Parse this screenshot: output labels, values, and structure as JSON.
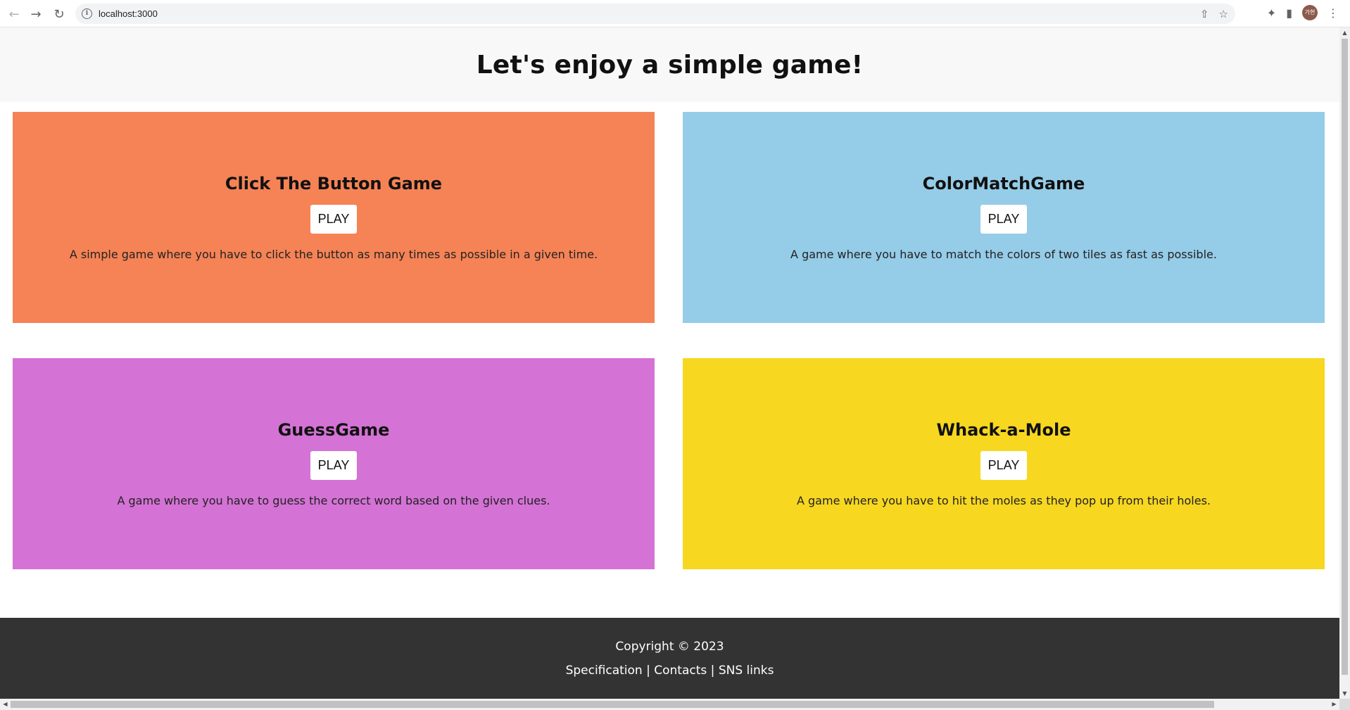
{
  "browser": {
    "url": "localhost:3000",
    "avatar_text": "가현",
    "icons": [
      "back-icon",
      "forward-icon",
      "reload-icon",
      "info-icon",
      "share-icon",
      "star-icon",
      "extensions-icon",
      "side-panel-icon",
      "menu-icon"
    ]
  },
  "header": {
    "title": "Let's enjoy a simple game!"
  },
  "games": [
    {
      "title": "Click The Button Game",
      "button": "PLAY",
      "description": "A simple game where you have to click the button as many times as possible in a given time.",
      "color": "#f58356"
    },
    {
      "title": "ColorMatchGame",
      "button": "PLAY",
      "description": "A game where you have to match the colors of two tiles as fast as possible.",
      "color": "#95cce8"
    },
    {
      "title": "GuessGame",
      "button": "PLAY",
      "description": "A game where you have to guess the correct word based on the given clues.",
      "color": "#d472d5"
    },
    {
      "title": "Whack-a-Mole",
      "button": "PLAY",
      "description": "A game where you have to hit the moles as they pop up from their holes.",
      "color": "#f7d720"
    }
  ],
  "footer": {
    "copyright": "Copyright © 2023",
    "links": [
      "Specification",
      "Contacts",
      "SNS links"
    ],
    "separator": " | "
  }
}
